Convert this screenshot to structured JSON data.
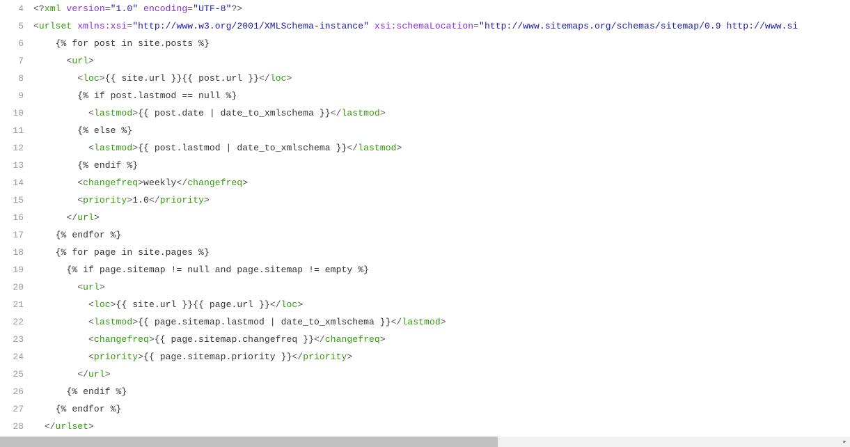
{
  "lines": [
    {
      "num": "4",
      "indent": "",
      "tokens": [
        {
          "c": "punc",
          "t": "<?"
        },
        {
          "c": "tag",
          "t": "xml "
        },
        {
          "c": "attr",
          "t": "version"
        },
        {
          "c": "punc",
          "t": "="
        },
        {
          "c": "str",
          "t": "\"1.0\""
        },
        {
          "c": "attr",
          "t": " encoding"
        },
        {
          "c": "punc",
          "t": "="
        },
        {
          "c": "str",
          "t": "\"UTF-8\""
        },
        {
          "c": "punc",
          "t": "?>"
        }
      ]
    },
    {
      "num": "5",
      "indent": "",
      "tokens": [
        {
          "c": "punc",
          "t": "<"
        },
        {
          "c": "tag",
          "t": "urlset "
        },
        {
          "c": "attr",
          "t": "xmlns:xsi"
        },
        {
          "c": "punc",
          "t": "="
        },
        {
          "c": "str",
          "t": "\"http://www.w3.org/2001/XMLSchema-instance\""
        },
        {
          "c": "attr",
          "t": " xsi:schemaLocation"
        },
        {
          "c": "punc",
          "t": "="
        },
        {
          "c": "str",
          "t": "\"http://www.sitemaps.org/schemas/sitemap/0.9 http://www.si"
        }
      ]
    },
    {
      "num": "6",
      "indent": "    ",
      "tokens": [
        {
          "c": "text",
          "t": "{% for post in site.posts %}"
        }
      ]
    },
    {
      "num": "7",
      "indent": "      ",
      "tokens": [
        {
          "c": "punc",
          "t": "<"
        },
        {
          "c": "tag",
          "t": "url"
        },
        {
          "c": "punc",
          "t": ">"
        }
      ]
    },
    {
      "num": "8",
      "indent": "        ",
      "tokens": [
        {
          "c": "punc",
          "t": "<"
        },
        {
          "c": "tag",
          "t": "loc"
        },
        {
          "c": "punc",
          "t": ">"
        },
        {
          "c": "text",
          "t": "{{ site.url }}{{ post.url }}"
        },
        {
          "c": "punc",
          "t": "</"
        },
        {
          "c": "tag",
          "t": "loc"
        },
        {
          "c": "punc",
          "t": ">"
        }
      ]
    },
    {
      "num": "9",
      "indent": "        ",
      "tokens": [
        {
          "c": "text",
          "t": "{% if post.lastmod == null %}"
        }
      ]
    },
    {
      "num": "10",
      "indent": "          ",
      "tokens": [
        {
          "c": "punc",
          "t": "<"
        },
        {
          "c": "tag",
          "t": "lastmod"
        },
        {
          "c": "punc",
          "t": ">"
        },
        {
          "c": "text",
          "t": "{{ post.date | date_to_xmlschema }}"
        },
        {
          "c": "punc",
          "t": "</"
        },
        {
          "c": "tag",
          "t": "lastmod"
        },
        {
          "c": "punc",
          "t": ">"
        }
      ]
    },
    {
      "num": "11",
      "indent": "        ",
      "tokens": [
        {
          "c": "text",
          "t": "{% else %}"
        }
      ]
    },
    {
      "num": "12",
      "indent": "          ",
      "tokens": [
        {
          "c": "punc",
          "t": "<"
        },
        {
          "c": "tag",
          "t": "lastmod"
        },
        {
          "c": "punc",
          "t": ">"
        },
        {
          "c": "text",
          "t": "{{ post.lastmod | date_to_xmlschema }}"
        },
        {
          "c": "punc",
          "t": "</"
        },
        {
          "c": "tag",
          "t": "lastmod"
        },
        {
          "c": "punc",
          "t": ">"
        }
      ]
    },
    {
      "num": "13",
      "indent": "        ",
      "tokens": [
        {
          "c": "text",
          "t": "{% endif %}"
        }
      ]
    },
    {
      "num": "14",
      "indent": "        ",
      "tokens": [
        {
          "c": "punc",
          "t": "<"
        },
        {
          "c": "tag",
          "t": "changefreq"
        },
        {
          "c": "punc",
          "t": ">"
        },
        {
          "c": "text",
          "t": "weekly"
        },
        {
          "c": "punc",
          "t": "</"
        },
        {
          "c": "tag",
          "t": "changefreq"
        },
        {
          "c": "punc",
          "t": ">"
        }
      ]
    },
    {
      "num": "15",
      "indent": "        ",
      "tokens": [
        {
          "c": "punc",
          "t": "<"
        },
        {
          "c": "tag",
          "t": "priority"
        },
        {
          "c": "punc",
          "t": ">"
        },
        {
          "c": "text",
          "t": "1.0"
        },
        {
          "c": "punc",
          "t": "</"
        },
        {
          "c": "tag",
          "t": "priority"
        },
        {
          "c": "punc",
          "t": ">"
        }
      ]
    },
    {
      "num": "16",
      "indent": "      ",
      "tokens": [
        {
          "c": "punc",
          "t": "</"
        },
        {
          "c": "tag",
          "t": "url"
        },
        {
          "c": "punc",
          "t": ">"
        }
      ]
    },
    {
      "num": "17",
      "indent": "    ",
      "tokens": [
        {
          "c": "text",
          "t": "{% endfor %}"
        }
      ]
    },
    {
      "num": "18",
      "indent": "    ",
      "tokens": [
        {
          "c": "text",
          "t": "{% for page in site.pages %}"
        }
      ]
    },
    {
      "num": "19",
      "indent": "      ",
      "tokens": [
        {
          "c": "text",
          "t": "{% if page.sitemap != null and page.sitemap != empty %}"
        }
      ]
    },
    {
      "num": "20",
      "indent": "        ",
      "tokens": [
        {
          "c": "punc",
          "t": "<"
        },
        {
          "c": "tag",
          "t": "url"
        },
        {
          "c": "punc",
          "t": ">"
        }
      ]
    },
    {
      "num": "21",
      "indent": "          ",
      "tokens": [
        {
          "c": "punc",
          "t": "<"
        },
        {
          "c": "tag",
          "t": "loc"
        },
        {
          "c": "punc",
          "t": ">"
        },
        {
          "c": "text",
          "t": "{{ site.url }}{{ page.url }}"
        },
        {
          "c": "punc",
          "t": "</"
        },
        {
          "c": "tag",
          "t": "loc"
        },
        {
          "c": "punc",
          "t": ">"
        }
      ]
    },
    {
      "num": "22",
      "indent": "          ",
      "tokens": [
        {
          "c": "punc",
          "t": "<"
        },
        {
          "c": "tag",
          "t": "lastmod"
        },
        {
          "c": "punc",
          "t": ">"
        },
        {
          "c": "text",
          "t": "{{ page.sitemap.lastmod | date_to_xmlschema }}"
        },
        {
          "c": "punc",
          "t": "</"
        },
        {
          "c": "tag",
          "t": "lastmod"
        },
        {
          "c": "punc",
          "t": ">"
        }
      ]
    },
    {
      "num": "23",
      "indent": "          ",
      "tokens": [
        {
          "c": "punc",
          "t": "<"
        },
        {
          "c": "tag",
          "t": "changefreq"
        },
        {
          "c": "punc",
          "t": ">"
        },
        {
          "c": "text",
          "t": "{{ page.sitemap.changefreq }}"
        },
        {
          "c": "punc",
          "t": "</"
        },
        {
          "c": "tag",
          "t": "changefreq"
        },
        {
          "c": "punc",
          "t": ">"
        }
      ]
    },
    {
      "num": "24",
      "indent": "          ",
      "tokens": [
        {
          "c": "punc",
          "t": "<"
        },
        {
          "c": "tag",
          "t": "priority"
        },
        {
          "c": "punc",
          "t": ">"
        },
        {
          "c": "text",
          "t": "{{ page.sitemap.priority }}"
        },
        {
          "c": "punc",
          "t": "</"
        },
        {
          "c": "tag",
          "t": "priority"
        },
        {
          "c": "punc",
          "t": ">"
        }
      ]
    },
    {
      "num": "25",
      "indent": "        ",
      "tokens": [
        {
          "c": "punc",
          "t": "</"
        },
        {
          "c": "tag",
          "t": "url"
        },
        {
          "c": "punc",
          "t": ">"
        }
      ]
    },
    {
      "num": "26",
      "indent": "      ",
      "tokens": [
        {
          "c": "text",
          "t": "{% endif %}"
        }
      ]
    },
    {
      "num": "27",
      "indent": "    ",
      "tokens": [
        {
          "c": "text",
          "t": "{% endfor %}"
        }
      ]
    },
    {
      "num": "28",
      "indent": "  ",
      "tokens": [
        {
          "c": "punc",
          "t": "</"
        },
        {
          "c": "tag",
          "t": "urlset"
        },
        {
          "c": "punc",
          "t": ">"
        }
      ]
    }
  ],
  "scroll_arrow": "▸"
}
